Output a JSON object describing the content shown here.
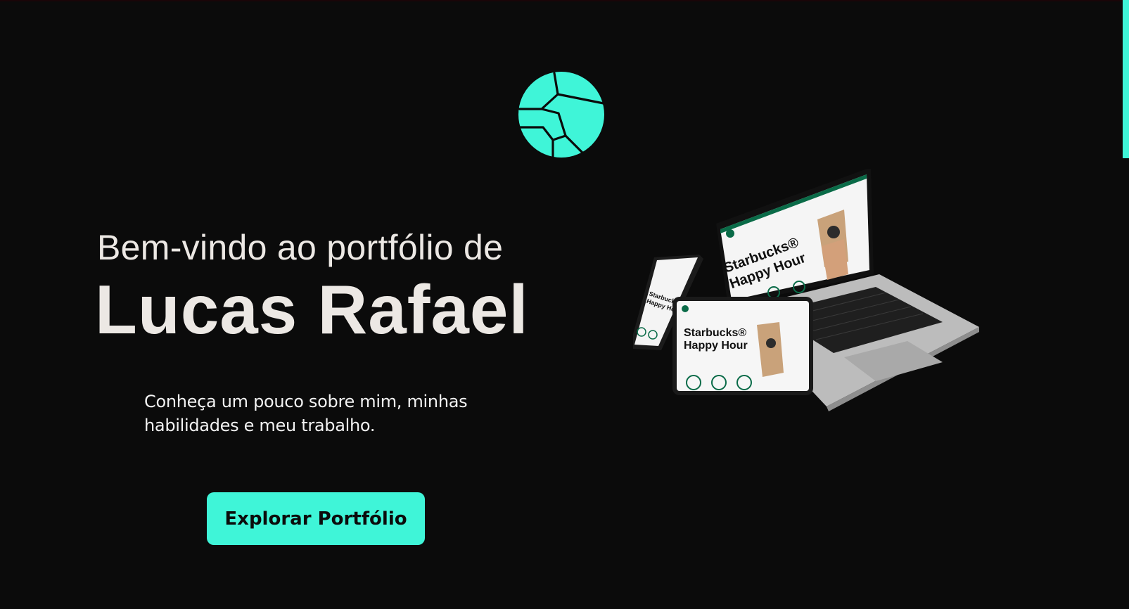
{
  "hero": {
    "greeting": "Bem-vindo ao portfólio de",
    "name": "Lucas Rafael",
    "tagline": "Conheça um pouco sobre mim, minhas habilidades e meu trabalho.",
    "cta_label": "Explorar Portfólio"
  },
  "mockup": {
    "laptop_title_line1": "Starbucks®",
    "laptop_title_line2": "Happy Hour",
    "tablet_title_line1": "Starbucks®",
    "tablet_title_line2": "Happy Hour",
    "phone_title_line1": "Starbucks®",
    "phone_title_line2": "Happy Ho"
  },
  "icons": {
    "logo": "cracked-circle-logo-icon"
  },
  "colors": {
    "background": "#0b0b0b",
    "accent": "#3ff5d8",
    "text": "#ece8e4"
  }
}
